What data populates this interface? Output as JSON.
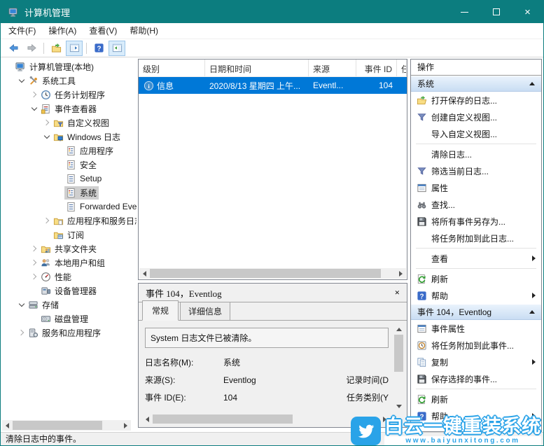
{
  "window": {
    "title": "计算机管理"
  },
  "menu": {
    "items": [
      "文件(F)",
      "操作(A)",
      "查看(V)",
      "帮助(H)"
    ]
  },
  "toolbar": {
    "buttons": [
      {
        "icon": "back-arrow"
      },
      {
        "icon": "forward-arrow"
      },
      {
        "sep": true
      },
      {
        "icon": "export-folder"
      },
      {
        "icon": "console-tree-toggle",
        "active": true
      },
      {
        "sep": true
      },
      {
        "icon": "help"
      },
      {
        "icon": "action-pane-toggle",
        "active": true
      }
    ]
  },
  "tree": {
    "items": [
      {
        "level": 0,
        "expander": "none",
        "icon": "computer",
        "label": "计算机管理(本地)"
      },
      {
        "level": 1,
        "expander": "expanded",
        "icon": "tools",
        "label": "系统工具"
      },
      {
        "level": 2,
        "expander": "collapsed",
        "icon": "clock",
        "label": "任务计划程序"
      },
      {
        "level": 2,
        "expander": "expanded",
        "icon": "eventviewer",
        "label": "事件查看器"
      },
      {
        "level": 3,
        "expander": "collapsed",
        "icon": "folder-filter",
        "label": "自定义视图"
      },
      {
        "level": 3,
        "expander": "expanded",
        "icon": "folder-monitor",
        "label": "Windows 日志"
      },
      {
        "level": 4,
        "expander": "none",
        "icon": "log-colored",
        "label": "应用程序"
      },
      {
        "level": 4,
        "expander": "none",
        "icon": "log-colored",
        "label": "安全"
      },
      {
        "level": 4,
        "expander": "none",
        "icon": "log-plain",
        "label": "Setup"
      },
      {
        "level": 4,
        "expander": "none",
        "icon": "log-colored",
        "label": "系统",
        "selected": true
      },
      {
        "level": 4,
        "expander": "none",
        "icon": "log-plain",
        "label": "Forwarded Eve"
      },
      {
        "level": 3,
        "expander": "collapsed",
        "icon": "folder-plain",
        "label": "应用程序和服务日志"
      },
      {
        "level": 3,
        "expander": "none",
        "icon": "folder-sub",
        "label": "订阅"
      },
      {
        "level": 2,
        "expander": "collapsed",
        "icon": "shared",
        "label": "共享文件夹"
      },
      {
        "level": 2,
        "expander": "collapsed",
        "icon": "users",
        "label": "本地用户和组"
      },
      {
        "level": 2,
        "expander": "collapsed",
        "icon": "perf",
        "label": "性能"
      },
      {
        "level": 2,
        "expander": "none",
        "icon": "devmgr",
        "label": "设备管理器"
      },
      {
        "level": 1,
        "expander": "expanded",
        "icon": "storage",
        "label": "存储"
      },
      {
        "level": 2,
        "expander": "none",
        "icon": "disk",
        "label": "磁盘管理"
      },
      {
        "level": 1,
        "expander": "collapsed",
        "icon": "services",
        "label": "服务和应用程序"
      }
    ]
  },
  "list": {
    "columns": [
      {
        "label": "级别",
        "width": 95,
        "align": "left"
      },
      {
        "label": "日期和时间",
        "width": 148,
        "align": "left"
      },
      {
        "label": "来源",
        "width": 68,
        "align": "left"
      },
      {
        "label": "事件 ID",
        "width": 58,
        "align": "right"
      },
      {
        "label": "任",
        "width": 14,
        "align": "left"
      }
    ],
    "row": {
      "icon": "info",
      "level": "信息",
      "date": "2020/8/13 星期四 上午...",
      "source": "Eventl...",
      "event_id": "104",
      "extra": ""
    }
  },
  "detail": {
    "title": "事件 104，Eventlog",
    "close_label": "×",
    "tabs": [
      {
        "label": "常规",
        "active": true
      },
      {
        "label": "详细信息",
        "active": false
      }
    ],
    "description": "System 日志文件已被清除。",
    "fields": [
      {
        "label": "日志名称(M):",
        "value": "系统",
        "right": ""
      },
      {
        "label": "来源(S):",
        "value": "Eventlog",
        "right": "记录时间(D"
      },
      {
        "label": "事件 ID(E):",
        "value": "104",
        "right": "任务类别(Y"
      }
    ]
  },
  "actions": {
    "title": "操作",
    "sections": [
      {
        "title": "系统",
        "items": [
          {
            "icon": "open-folder",
            "label": "打开保存的日志..."
          },
          {
            "icon": "funnel",
            "label": "创建自定义视图..."
          },
          {
            "icon": null,
            "label": "导入自定义视图..."
          },
          {
            "sep": true
          },
          {
            "icon": null,
            "label": "清除日志..."
          },
          {
            "icon": "funnel",
            "label": "筛选当前日志..."
          },
          {
            "icon": "props",
            "label": "属性"
          },
          {
            "icon": "binoculars",
            "label": "查找..."
          },
          {
            "icon": "floppy",
            "label": "将所有事件另存为..."
          },
          {
            "icon": null,
            "label": "将任务附加到此日志..."
          },
          {
            "sep": true
          },
          {
            "icon": null,
            "label": "查看",
            "arrow": true
          },
          {
            "sep": true
          },
          {
            "icon": "refresh",
            "label": "刷新"
          },
          {
            "icon": "help",
            "label": "帮助",
            "arrow": true
          }
        ]
      },
      {
        "title": "事件 104，Eventlog",
        "items": [
          {
            "icon": "props",
            "label": "事件属性"
          },
          {
            "icon": "task-clock",
            "label": "将任务附加到此事件..."
          },
          {
            "icon": "copy",
            "label": "复制",
            "arrow": true
          },
          {
            "icon": "floppy",
            "label": "保存选择的事件..."
          },
          {
            "sep": true
          },
          {
            "icon": "refresh",
            "label": "刷新"
          },
          {
            "icon": "help",
            "label": "帮助",
            "arrow": true
          }
        ]
      }
    ]
  },
  "statusbar": {
    "text": "清除日志中的事件。"
  },
  "watermark": {
    "title": "白云一键重装系统",
    "url": "www.baiyunxitong.com"
  },
  "colors": {
    "titlebar": "#0c7d7f",
    "selection": "#0078d7",
    "watermark_blue": "#2aa3e8"
  }
}
